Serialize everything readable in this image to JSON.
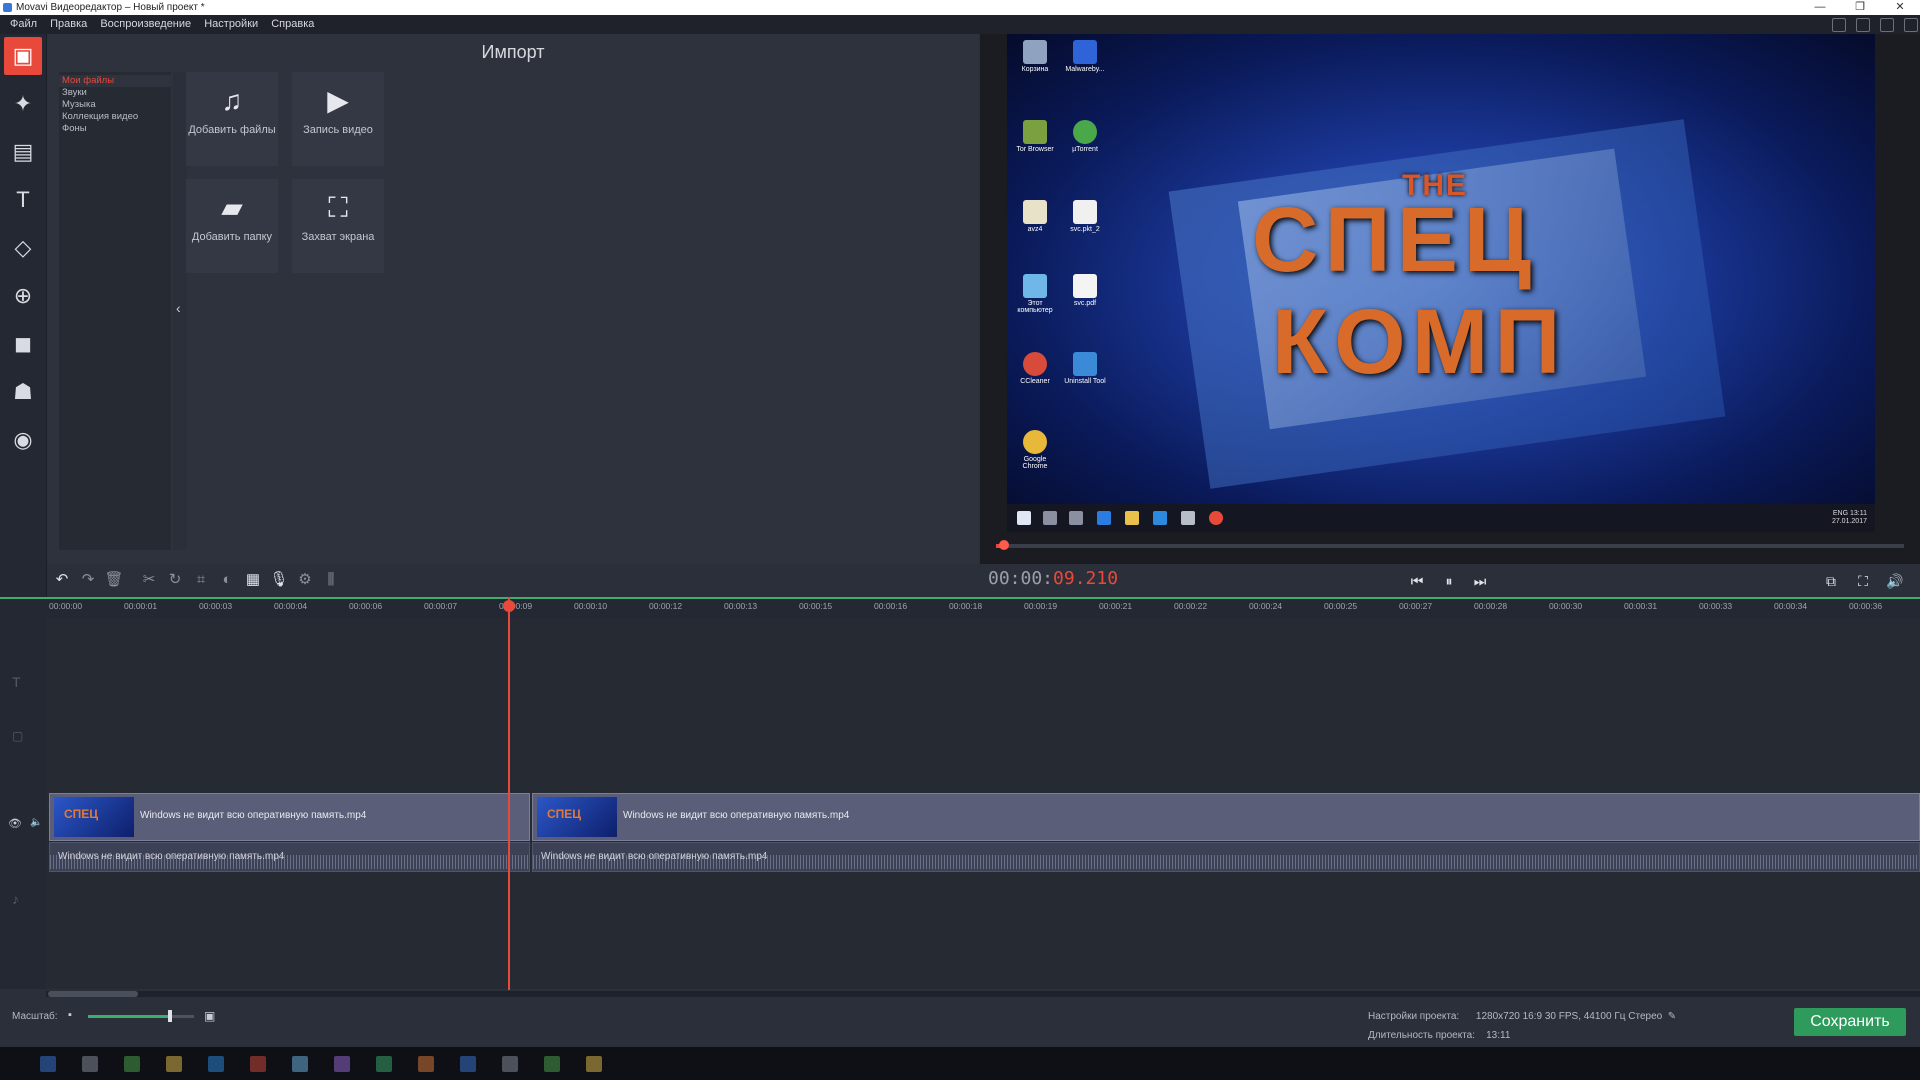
{
  "window": {
    "title": "Movavi Видеоредактор – Новый проект *",
    "controls": [
      "—",
      "❐",
      "✕"
    ]
  },
  "menu": [
    "Файл",
    "Правка",
    "Воспроизведение",
    "Настройки",
    "Справка"
  ],
  "import": {
    "title": "Импорт",
    "categories": [
      "Мои файлы",
      "Звуки",
      "Музыка",
      "Коллекция видео",
      "Фоны"
    ],
    "tiles": [
      {
        "label": "Добавить файлы",
        "icon": "add-files-icon"
      },
      {
        "label": "Запись видео",
        "icon": "record-video-icon"
      },
      {
        "label": "Добавить папку",
        "icon": "add-folder-icon"
      },
      {
        "label": "Захват экрана",
        "icon": "screen-capture-icon"
      }
    ],
    "collapse_glyph": "‹"
  },
  "preview": {
    "logo_top": "THE",
    "logo_mid": "СПЕЦ",
    "logo_bottom": "КОМП",
    "desktop_icons": [
      "Корзина",
      "Malwareby...",
      "Tor Browser",
      "µTorrent",
      "avz4",
      "svc.pkt_2",
      "Этот компьютер",
      "svc.pdf",
      "CCleaner",
      "Uninstall Tool",
      "Google Chrome"
    ],
    "tray": {
      "lang": "ENG",
      "time": "13:11",
      "date": "27.01.2017"
    },
    "progress": 0.009
  },
  "timecode": {
    "prefix": "00:00:",
    "current": "09.210"
  },
  "playback": {
    "prev": "⏮",
    "play": "⏸",
    "next": "⏭",
    "popout": "⧉",
    "fullscreen": "⛶",
    "volume": "🔊"
  },
  "ruler": [
    "00:00:00",
    "00:00:01",
    "00:00:03",
    "00:00:04",
    "00:00:06",
    "00:00:07",
    "00:00:09",
    "00:00:10",
    "00:00:12",
    "00:00:13",
    "00:00:15",
    "00:00:16",
    "00:00:18",
    "00:00:19",
    "00:00:21",
    "00:00:22",
    "00:00:24",
    "00:00:25",
    "00:00:27",
    "00:00:28",
    "00:00:30",
    "00:00:31",
    "00:00:33",
    "00:00:34",
    "00:00:36"
  ],
  "clips": [
    {
      "video": "Windows не видит всю оперативную память.mp4",
      "audio": "Windows не видит всю оперативную память.mp4",
      "thumb": "СПЕЦ"
    },
    {
      "video": "Windows не видит всю оперативную память.mp4",
      "audio": "Windows не видит всю оперативную память.mp4",
      "thumb": "СПЕЦ"
    }
  ],
  "bottom": {
    "zoom_label": "Масштаб:",
    "zoom_level": 0.77,
    "project_settings_label": "Настройки проекта:",
    "project_settings_value": "1280x720 16:9 30 FPS, 44100 Гц Стерео",
    "duration_label": "Длительность проекта:",
    "duration_value": "13:11",
    "save": "Сохранить"
  },
  "colors": {
    "accent": "#e8493b",
    "save": "#2e9a5c",
    "ruler_line": "#3cae6f"
  }
}
